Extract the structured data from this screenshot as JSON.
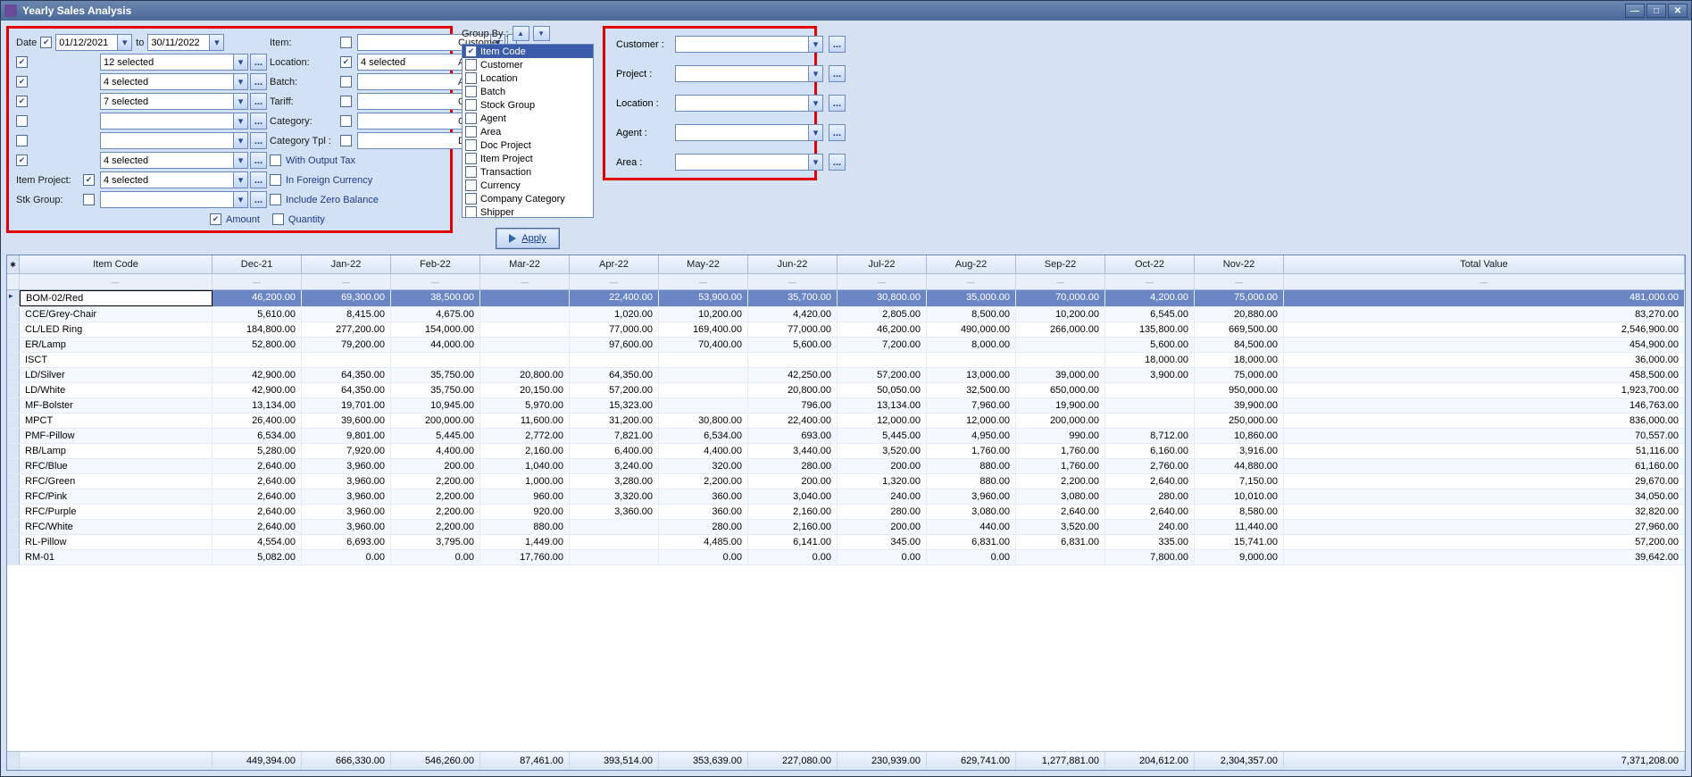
{
  "window": {
    "title": "Yearly Sales Analysis",
    "min": "—",
    "max": "□",
    "close": "✕"
  },
  "filters": {
    "date_label": "Date",
    "date_from": "01/12/2021",
    "date_to_label": "to",
    "date_to": "30/11/2022",
    "item_label": "Item:",
    "customer_label": "Customer:",
    "customer_value": "12 selected",
    "location_label": "Location:",
    "location_value": "4 selected",
    "agent_label": "Agent:",
    "agent_value": "4 selected",
    "batch_label": "Batch:",
    "area_label": "Area:",
    "area_value": "7 selected",
    "tariff_label": "Tariff:",
    "currency_label": "Currency:",
    "category_label": "Category:",
    "cocat_label": "Co. Category:",
    "cattpl_label": "Category Tpl :",
    "docproj_label": "Doc Project:",
    "docproj_value": "4 selected",
    "itemproj_label": "Item Project:",
    "itemproj_value": "4 selected",
    "stkgroup_label": "Stk Group:",
    "with_output_tax": "With Output Tax",
    "in_foreign_currency": "In Foreign Currency",
    "include_zero_balance": "Include Zero Balance",
    "amount_label": "Amount",
    "quantity_label": "Quantity"
  },
  "groupby": {
    "label": "Group By :",
    "items": [
      {
        "label": "Item Code",
        "checked": true,
        "selected": true
      },
      {
        "label": "Customer",
        "checked": false
      },
      {
        "label": "Location",
        "checked": false
      },
      {
        "label": "Batch",
        "checked": false
      },
      {
        "label": "Stock Group",
        "checked": false
      },
      {
        "label": "Agent",
        "checked": false
      },
      {
        "label": "Area",
        "checked": false
      },
      {
        "label": "Doc Project",
        "checked": false
      },
      {
        "label": "Item Project",
        "checked": false
      },
      {
        "label": "Transaction",
        "checked": false
      },
      {
        "label": "Currency",
        "checked": false
      },
      {
        "label": "Company Category",
        "checked": false
      },
      {
        "label": "Shipper",
        "checked": false
      }
    ]
  },
  "right_filters": {
    "customer": "Customer :",
    "project": "Project :",
    "location": "Location :",
    "agent": "Agent :",
    "area": "Area :",
    "ellipsis": "..."
  },
  "apply_label": "Apply",
  "columns": [
    "Item Code",
    "Dec-21",
    "Jan-22",
    "Feb-22",
    "Mar-22",
    "Apr-22",
    "May-22",
    "Jun-22",
    "Jul-22",
    "Aug-22",
    "Sep-22",
    "Oct-22",
    "Nov-22",
    "Total Value"
  ],
  "rows": [
    {
      "code": "BOM-02/Red",
      "v": [
        "46,200.00",
        "69,300.00",
        "38,500.00",
        "",
        "22,400.00",
        "53,900.00",
        "35,700.00",
        "30,800.00",
        "35,000.00",
        "70,000.00",
        "4,200.00",
        "75,000.00",
        "481,000.00"
      ],
      "selected": true
    },
    {
      "code": "CCE/Grey-Chair",
      "v": [
        "5,610.00",
        "8,415.00",
        "4,675.00",
        "",
        "1,020.00",
        "10,200.00",
        "4,420.00",
        "2,805.00",
        "8,500.00",
        "10,200.00",
        "6,545.00",
        "20,880.00",
        "83,270.00"
      ]
    },
    {
      "code": "CL/LED Ring",
      "v": [
        "184,800.00",
        "277,200.00",
        "154,000.00",
        "",
        "77,000.00",
        "169,400.00",
        "77,000.00",
        "46,200.00",
        "490,000.00",
        "266,000.00",
        "135,800.00",
        "669,500.00",
        "2,546,900.00"
      ]
    },
    {
      "code": "ER/Lamp",
      "v": [
        "52,800.00",
        "79,200.00",
        "44,000.00",
        "",
        "97,600.00",
        "70,400.00",
        "5,600.00",
        "7,200.00",
        "8,000.00",
        "",
        "5,600.00",
        "84,500.00",
        "454,900.00"
      ]
    },
    {
      "code": "ISCT",
      "v": [
        "",
        "",
        "",
        "",
        "",
        "",
        "",
        "",
        "",
        "",
        "18,000.00",
        "18,000.00",
        "36,000.00"
      ]
    },
    {
      "code": "LD/Silver",
      "v": [
        "42,900.00",
        "64,350.00",
        "35,750.00",
        "20,800.00",
        "64,350.00",
        "",
        "42,250.00",
        "57,200.00",
        "13,000.00",
        "39,000.00",
        "3,900.00",
        "75,000.00",
        "458,500.00"
      ]
    },
    {
      "code": "LD/White",
      "v": [
        "42,900.00",
        "64,350.00",
        "35,750.00",
        "20,150.00",
        "57,200.00",
        "",
        "20,800.00",
        "50,050.00",
        "32,500.00",
        "650,000.00",
        "",
        "950,000.00",
        "1,923,700.00"
      ]
    },
    {
      "code": "MF-Bolster",
      "v": [
        "13,134.00",
        "19,701.00",
        "10,945.00",
        "5,970.00",
        "15,323.00",
        "",
        "796.00",
        "13,134.00",
        "7,960.00",
        "19,900.00",
        "",
        "39,900.00",
        "146,763.00"
      ]
    },
    {
      "code": "MPCT",
      "v": [
        "26,400.00",
        "39,600.00",
        "200,000.00",
        "11,600.00",
        "31,200.00",
        "30,800.00",
        "22,400.00",
        "12,000.00",
        "12,000.00",
        "200,000.00",
        "",
        "250,000.00",
        "836,000.00"
      ]
    },
    {
      "code": "PMF-Pillow",
      "v": [
        "6,534.00",
        "9,801.00",
        "5,445.00",
        "2,772.00",
        "7,821.00",
        "6,534.00",
        "693.00",
        "5,445.00",
        "4,950.00",
        "990.00",
        "8,712.00",
        "10,860.00",
        "70,557.00"
      ]
    },
    {
      "code": "RB/Lamp",
      "v": [
        "5,280.00",
        "7,920.00",
        "4,400.00",
        "2,160.00",
        "6,400.00",
        "4,400.00",
        "3,440.00",
        "3,520.00",
        "1,760.00",
        "1,760.00",
        "6,160.00",
        "3,916.00",
        "51,116.00"
      ]
    },
    {
      "code": "RFC/Blue",
      "v": [
        "2,640.00",
        "3,960.00",
        "200.00",
        "1,040.00",
        "3,240.00",
        "320.00",
        "280.00",
        "200.00",
        "880.00",
        "1,760.00",
        "2,760.00",
        "44,880.00",
        "61,160.00"
      ]
    },
    {
      "code": "RFC/Green",
      "v": [
        "2,640.00",
        "3,960.00",
        "2,200.00",
        "1,000.00",
        "3,280.00",
        "2,200.00",
        "200.00",
        "1,320.00",
        "880.00",
        "2,200.00",
        "2,640.00",
        "7,150.00",
        "29,670.00"
      ]
    },
    {
      "code": "RFC/Pink",
      "v": [
        "2,640.00",
        "3,960.00",
        "2,200.00",
        "960.00",
        "3,320.00",
        "360.00",
        "3,040.00",
        "240.00",
        "3,960.00",
        "3,080.00",
        "280.00",
        "10,010.00",
        "34,050.00"
      ]
    },
    {
      "code": "RFC/Purple",
      "v": [
        "2,640.00",
        "3,960.00",
        "2,200.00",
        "920.00",
        "3,360.00",
        "360.00",
        "2,160.00",
        "280.00",
        "3,080.00",
        "2,640.00",
        "2,640.00",
        "8,580.00",
        "32,820.00"
      ]
    },
    {
      "code": "RFC/White",
      "v": [
        "2,640.00",
        "3,960.00",
        "2,200.00",
        "880.00",
        "",
        "280.00",
        "2,160.00",
        "200.00",
        "440.00",
        "3,520.00",
        "240.00",
        "11,440.00",
        "27,960.00"
      ]
    },
    {
      "code": "RL-Pillow",
      "v": [
        "4,554.00",
        "6,693.00",
        "3,795.00",
        "1,449.00",
        "",
        "4,485.00",
        "6,141.00",
        "345.00",
        "6,831.00",
        "6,831.00",
        "335.00",
        "15,741.00",
        "57,200.00"
      ]
    },
    {
      "code": "RM-01",
      "v": [
        "5,082.00",
        "0.00",
        "0.00",
        "17,760.00",
        "",
        "0.00",
        "0.00",
        "0.00",
        "0.00",
        "",
        "7,800.00",
        "9,000.00",
        "39,642.00"
      ]
    }
  ],
  "totals": [
    "449,394.00",
    "666,330.00",
    "546,260.00",
    "87,461.00",
    "393,514.00",
    "353,639.00",
    "227,080.00",
    "230,939.00",
    "629,741.00",
    "1,277,881.00",
    "204,612.00",
    "2,304,357.00",
    "7,371,208.00"
  ]
}
